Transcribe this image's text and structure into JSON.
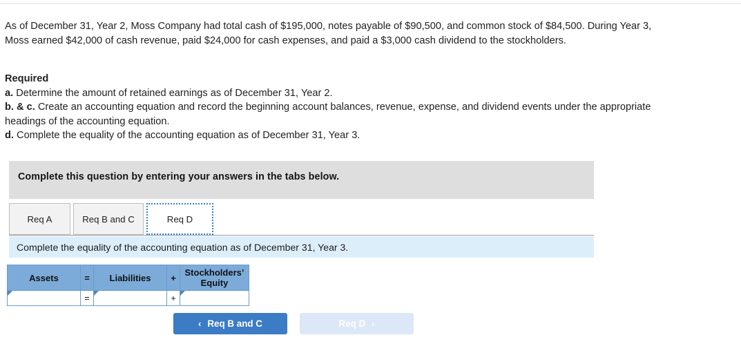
{
  "problem": {
    "paragraph": "As of December 31, Year 2, Moss Company had total cash of $195,000, notes payable of $90,500, and common stock of $84,500. During Year 3, Moss earned $42,000 of cash revenue, paid $24,000 for cash expenses, and paid a $3,000 cash dividend to the stockholders."
  },
  "required": {
    "title": "Required",
    "item_a_label": "a.",
    "item_a_text": " Determine the amount of retained earnings as of December 31, Year 2.",
    "item_bc_label": "b. & c.",
    "item_bc_text": " Create an accounting equation and record the beginning account balances, revenue, expense, and dividend events under the appropriate headings of the accounting equation.",
    "item_d_label": "d.",
    "item_d_text": " Complete the equality of the accounting equation as of December 31, Year 3."
  },
  "banner": {
    "text": "Complete this question by entering your answers in the tabs below."
  },
  "tabs": [
    {
      "id": "req-a",
      "label": "Req A",
      "active": false
    },
    {
      "id": "req-b-and-c",
      "label": "Req B and C",
      "active": false
    },
    {
      "id": "req-d",
      "label": "Req D",
      "active": true
    }
  ],
  "info_bar": {
    "text": "Complete the equality of the accounting equation as of December 31, Year 3."
  },
  "equation_table": {
    "headers": [
      "Assets",
      "=",
      "Liabilities",
      "+",
      "Stockholders’ Equity"
    ],
    "row": {
      "assets_value": "",
      "equals_operator": "=",
      "liabilities_value": "",
      "plus_operator": "+",
      "stockholders_equity_value": ""
    }
  },
  "navigation": {
    "prev_label": "Req B and C",
    "prev_icon": "chevron-left-icon",
    "prev_chevron": "‹",
    "next_label": "Req D",
    "next_icon": "chevron-right-icon",
    "next_chevron": "›",
    "next_disabled": true
  },
  "colors": {
    "banner_gray": "#dedede",
    "info_blue": "#ddeefb",
    "table_header_blue": "#7cabda",
    "table_border_blue": "#6b9bc9",
    "button_blue": "#3b7cc4",
    "button_disabled_blue": "#dce8f7",
    "tab_focus_blue": "#2d7fd3"
  }
}
